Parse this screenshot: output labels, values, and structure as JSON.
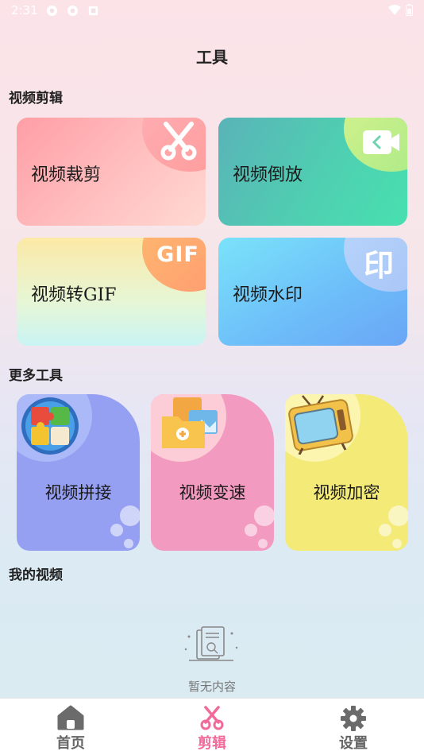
{
  "status": {
    "time": "2:31"
  },
  "header": {
    "title": "工具"
  },
  "sections": {
    "video_edit": "视频剪辑",
    "more_tools": "更多工具",
    "my_videos": "我的视频"
  },
  "cards": [
    {
      "label": "视频裁剪",
      "icon": "scissors-icon"
    },
    {
      "label": "视频倒放",
      "icon": "video-camera-icon"
    },
    {
      "label": "视频转GIF",
      "icon": "gif-icon",
      "icon_text": "GIF"
    },
    {
      "label": "视频水印",
      "icon": "watermark-icon",
      "icon_text": "印"
    }
  ],
  "tools": [
    {
      "label": "视频拼接",
      "icon": "puzzle-icon"
    },
    {
      "label": "视频变速",
      "icon": "photos-icon"
    },
    {
      "label": "视频加密",
      "icon": "tv-icon"
    }
  ],
  "empty": {
    "text": "暂无内容"
  },
  "tabs": [
    {
      "label": "首页",
      "icon": "home-icon",
      "active": false
    },
    {
      "label": "剪辑",
      "icon": "scissors-icon",
      "active": true
    },
    {
      "label": "设置",
      "icon": "gear-icon",
      "active": false
    }
  ],
  "colors": {
    "active_tab": "#f06a9a",
    "inactive_tab": "#666666"
  }
}
